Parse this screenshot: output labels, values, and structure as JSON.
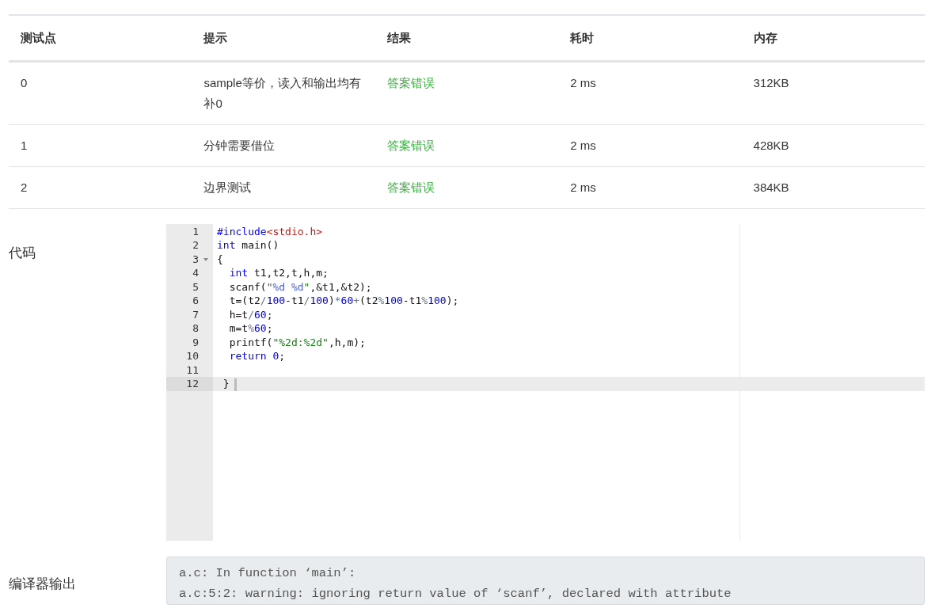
{
  "results_table": {
    "columns": [
      "测试点",
      "提示",
      "结果",
      "耗时",
      "内存"
    ],
    "rows": [
      {
        "case": "0",
        "hint": "sample等价，读入和输出均有补0",
        "result": "答案错误",
        "time": "2 ms",
        "memory": "312KB"
      },
      {
        "case": "1",
        "hint": "分钟需要借位",
        "result": "答案错误",
        "time": "2 ms",
        "memory": "428KB"
      },
      {
        "case": "2",
        "hint": "边界测试",
        "result": "答案错误",
        "time": "2 ms",
        "memory": "384KB"
      }
    ]
  },
  "code": {
    "label": "代码",
    "lines": [
      {
        "number": "1",
        "foldable": false,
        "active": false,
        "tokens": [
          {
            "kind": "directive",
            "text": "#include"
          },
          {
            "kind": "header",
            "text": "<stdio.h>"
          }
        ]
      },
      {
        "number": "2",
        "foldable": false,
        "active": false,
        "tokens": [
          {
            "kind": "keyword",
            "text": "int"
          },
          {
            "kind": "plain",
            "text": " main()"
          }
        ]
      },
      {
        "number": "3",
        "foldable": true,
        "active": false,
        "tokens": [
          {
            "kind": "plain",
            "text": "{"
          }
        ]
      },
      {
        "number": "4",
        "foldable": false,
        "active": false,
        "tokens": [
          {
            "kind": "keyword",
            "text": "  int"
          },
          {
            "kind": "plain",
            "text": " t1,t2,t,h,m;"
          }
        ]
      },
      {
        "number": "5",
        "foldable": false,
        "active": false,
        "tokens": [
          {
            "kind": "plain",
            "text": "  scanf("
          },
          {
            "kind": "string",
            "text": "\""
          },
          {
            "kind": "escape",
            "text": "%d %d"
          },
          {
            "kind": "string",
            "text": "\""
          },
          {
            "kind": "plain",
            "text": ",&t1,&t2);"
          }
        ]
      },
      {
        "number": "6",
        "foldable": false,
        "active": false,
        "tokens": [
          {
            "kind": "plain",
            "text": "  t=(t2"
          },
          {
            "kind": "operator",
            "text": "/"
          },
          {
            "kind": "number",
            "text": "100"
          },
          {
            "kind": "plain",
            "text": "-t1"
          },
          {
            "kind": "operator",
            "text": "/"
          },
          {
            "kind": "number",
            "text": "100"
          },
          {
            "kind": "plain",
            "text": ")"
          },
          {
            "kind": "operator",
            "text": "*"
          },
          {
            "kind": "number",
            "text": "60"
          },
          {
            "kind": "operator",
            "text": "+"
          },
          {
            "kind": "plain",
            "text": "(t2"
          },
          {
            "kind": "operator",
            "text": "%"
          },
          {
            "kind": "number",
            "text": "100"
          },
          {
            "kind": "plain",
            "text": "-t1"
          },
          {
            "kind": "operator",
            "text": "%"
          },
          {
            "kind": "number",
            "text": "100"
          },
          {
            "kind": "plain",
            "text": ");"
          }
        ]
      },
      {
        "number": "7",
        "foldable": false,
        "active": false,
        "tokens": [
          {
            "kind": "plain",
            "text": "  h=t"
          },
          {
            "kind": "operator",
            "text": "/"
          },
          {
            "kind": "number",
            "text": "60"
          },
          {
            "kind": "plain",
            "text": ";"
          }
        ]
      },
      {
        "number": "8",
        "foldable": false,
        "active": false,
        "tokens": [
          {
            "kind": "plain",
            "text": "  m=t"
          },
          {
            "kind": "operator",
            "text": "%"
          },
          {
            "kind": "number",
            "text": "60"
          },
          {
            "kind": "plain",
            "text": ";"
          }
        ]
      },
      {
        "number": "9",
        "foldable": false,
        "active": false,
        "tokens": [
          {
            "kind": "plain",
            "text": "  printf("
          },
          {
            "kind": "string",
            "text": "\"%2d:%2d\""
          },
          {
            "kind": "plain",
            "text": ",h,m);"
          }
        ]
      },
      {
        "number": "10",
        "foldable": false,
        "active": false,
        "tokens": [
          {
            "kind": "keyword",
            "text": "  return"
          },
          {
            "kind": "number",
            "text": " 0"
          },
          {
            "kind": "plain",
            "text": ";"
          }
        ]
      },
      {
        "number": "11",
        "foldable": false,
        "active": false
      },
      {
        "number": "12",
        "foldable": false,
        "active": true,
        "tokens": [
          {
            "kind": "plain",
            "text": " }"
          }
        ]
      }
    ]
  },
  "compiler_output": {
    "label": "编译器输出",
    "lines": [
      "a.c: In function ‘main’:",
      "a.c:5:2: warning: ignoring return value of ‘scanf’, declared with attribute"
    ]
  }
}
